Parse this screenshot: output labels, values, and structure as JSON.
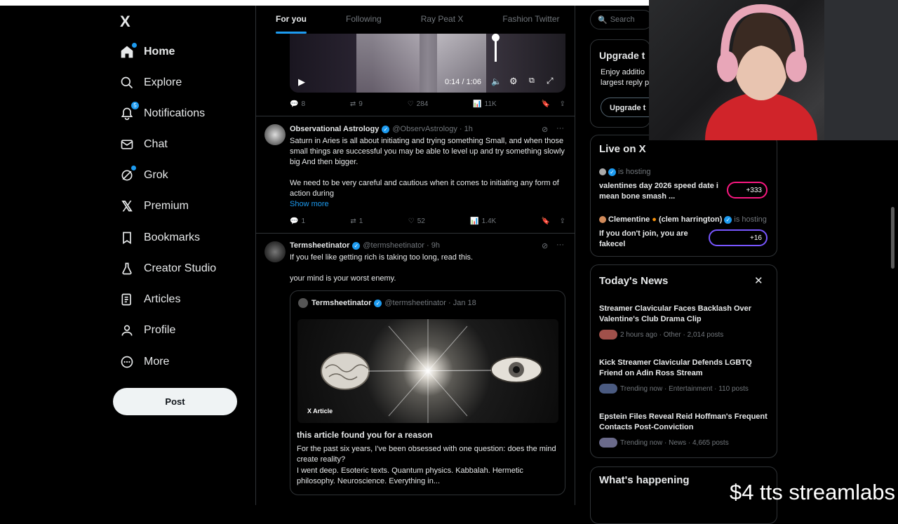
{
  "nav": {
    "logo": "X",
    "items": [
      {
        "label": "Home",
        "icon": "home-icon"
      },
      {
        "label": "Explore",
        "icon": "search-icon"
      },
      {
        "label": "Notifications",
        "icon": "bell-icon",
        "badge": "5"
      },
      {
        "label": "Chat",
        "icon": "mail-icon"
      },
      {
        "label": "Grok",
        "icon": "grok-icon"
      },
      {
        "label": "Premium",
        "icon": "x-icon"
      },
      {
        "label": "Bookmarks",
        "icon": "bookmark-icon"
      },
      {
        "label": "Creator Studio",
        "icon": "flask-icon"
      },
      {
        "label": "Articles",
        "icon": "article-icon"
      },
      {
        "label": "Profile",
        "icon": "person-icon"
      },
      {
        "label": "More",
        "icon": "more-circle-icon"
      }
    ],
    "post_label": "Post"
  },
  "tabs": [
    "For you",
    "Following",
    "Ray Peat X",
    "Fashion Twitter"
  ],
  "video": {
    "time": "0:14 / 1:06"
  },
  "tweet0_actions": {
    "replies": "8",
    "reposts": "9",
    "likes": "284",
    "views": "11K"
  },
  "tweet1": {
    "name": "Observational Astrology",
    "handle": "@ObservAstrology · 1h",
    "text1": "Saturn in Aries is all about initiating and trying something Small, and when those small things are successful you may be able to level up and try something slowly big And then bigger.",
    "text2": "We need to be very careful and cautious when it comes to initiating any form of action during",
    "show_more": "Show more",
    "replies": "1",
    "reposts": "1",
    "likes": "52",
    "views": "1.4K"
  },
  "tweet2": {
    "name": "Termsheetinator",
    "handle": "@termsheetinator · 9h",
    "text1": "If you feel like getting rich is taking too long, read this.",
    "text2": "your mind is your worst enemy.",
    "quote": {
      "name": "Termsheetinator",
      "handle": "@termsheetinator · Jan 18",
      "tag": "X Article",
      "title": "this article found you for a reason",
      "text": "For the past six years, I've been obsessed with one question: does the mind create reality?",
      "text2": "I went deep. Esoteric texts. Quantum physics. Kabbalah. Hermetic philosophy. Neuroscience. Everything in..."
    }
  },
  "right": {
    "search_placeholder": "Search",
    "upgrade": {
      "title": "Upgrade t",
      "line1": "Enjoy additio",
      "line2": "largest reply p",
      "button": "Upgrade t"
    },
    "live": {
      "title": "Live on X",
      "items": [
        {
          "host": "is hosting",
          "title": "valentines day 2026 speed date i mean bone smash ...",
          "count": "+333"
        },
        {
          "host": "Clementine",
          "host_suffix": "(clem harrington)",
          "hosting": "is hosting",
          "title": "If you don't join, you are fakecel",
          "count": "+16"
        }
      ]
    },
    "news": {
      "title": "Today's News",
      "items": [
        {
          "headline": "Streamer Clavicular Faces Backlash Over Valentine's Club Drama Clip",
          "meta": "2 hours ago · Other · 2,014 posts"
        },
        {
          "headline": "Kick Streamer Clavicular Defends LGBTQ Friend on Adin Ross Stream",
          "meta": "Trending now · Entertainment · 110 posts"
        },
        {
          "headline": "Epstein Files Reveal Reid Hoffman's Frequent Contacts Post-Conviction",
          "meta": "Trending now · News · 4,665 posts"
        }
      ]
    },
    "happening": {
      "title": "What's happening"
    }
  },
  "overlay": "$4 tts streamlabs",
  "colors": {
    "accent": "#1d9bf0",
    "bg": "#000000",
    "border": "#2f3336",
    "muted": "#71767b"
  }
}
